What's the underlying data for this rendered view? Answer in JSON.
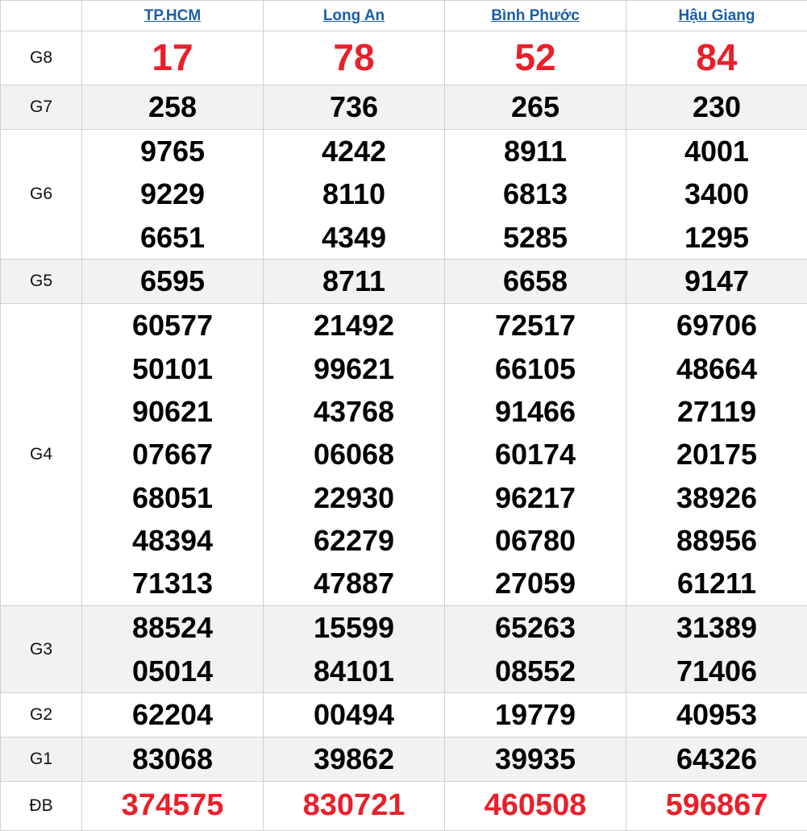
{
  "provinces": [
    "TP.HCM",
    "Long An",
    "Bình Phước",
    "Hậu Giang"
  ],
  "colors": {
    "link": "#1a5ea8",
    "highlight": "#e8202a",
    "alt_row": "#f2f2f2",
    "border": "#d0d0d0"
  },
  "prizes": [
    {
      "label": "G8",
      "values": [
        [
          "17"
        ],
        [
          "78"
        ],
        [
          "52"
        ],
        [
          "84"
        ]
      ]
    },
    {
      "label": "G7",
      "values": [
        [
          "258"
        ],
        [
          "736"
        ],
        [
          "265"
        ],
        [
          "230"
        ]
      ]
    },
    {
      "label": "G6",
      "values": [
        [
          "9765",
          "9229",
          "6651"
        ],
        [
          "4242",
          "8110",
          "4349"
        ],
        [
          "8911",
          "6813",
          "5285"
        ],
        [
          "4001",
          "3400",
          "1295"
        ]
      ]
    },
    {
      "label": "G5",
      "values": [
        [
          "6595"
        ],
        [
          "8711"
        ],
        [
          "6658"
        ],
        [
          "9147"
        ]
      ]
    },
    {
      "label": "G4",
      "values": [
        [
          "60577",
          "50101",
          "90621",
          "07667",
          "68051",
          "48394",
          "71313"
        ],
        [
          "21492",
          "99621",
          "43768",
          "06068",
          "22930",
          "62279",
          "47887"
        ],
        [
          "72517",
          "66105",
          "91466",
          "60174",
          "96217",
          "06780",
          "27059"
        ],
        [
          "69706",
          "48664",
          "27119",
          "20175",
          "38926",
          "88956",
          "61211"
        ]
      ]
    },
    {
      "label": "G3",
      "values": [
        [
          "88524",
          "05014"
        ],
        [
          "15599",
          "84101"
        ],
        [
          "65263",
          "08552"
        ],
        [
          "31389",
          "71406"
        ]
      ]
    },
    {
      "label": "G2",
      "values": [
        [
          "62204"
        ],
        [
          "00494"
        ],
        [
          "19779"
        ],
        [
          "40953"
        ]
      ]
    },
    {
      "label": "G1",
      "values": [
        [
          "83068"
        ],
        [
          "39862"
        ],
        [
          "39935"
        ],
        [
          "64326"
        ]
      ]
    },
    {
      "label": "ĐB",
      "values": [
        [
          "374575"
        ],
        [
          "830721"
        ],
        [
          "460508"
        ],
        [
          "596867"
        ]
      ]
    }
  ]
}
